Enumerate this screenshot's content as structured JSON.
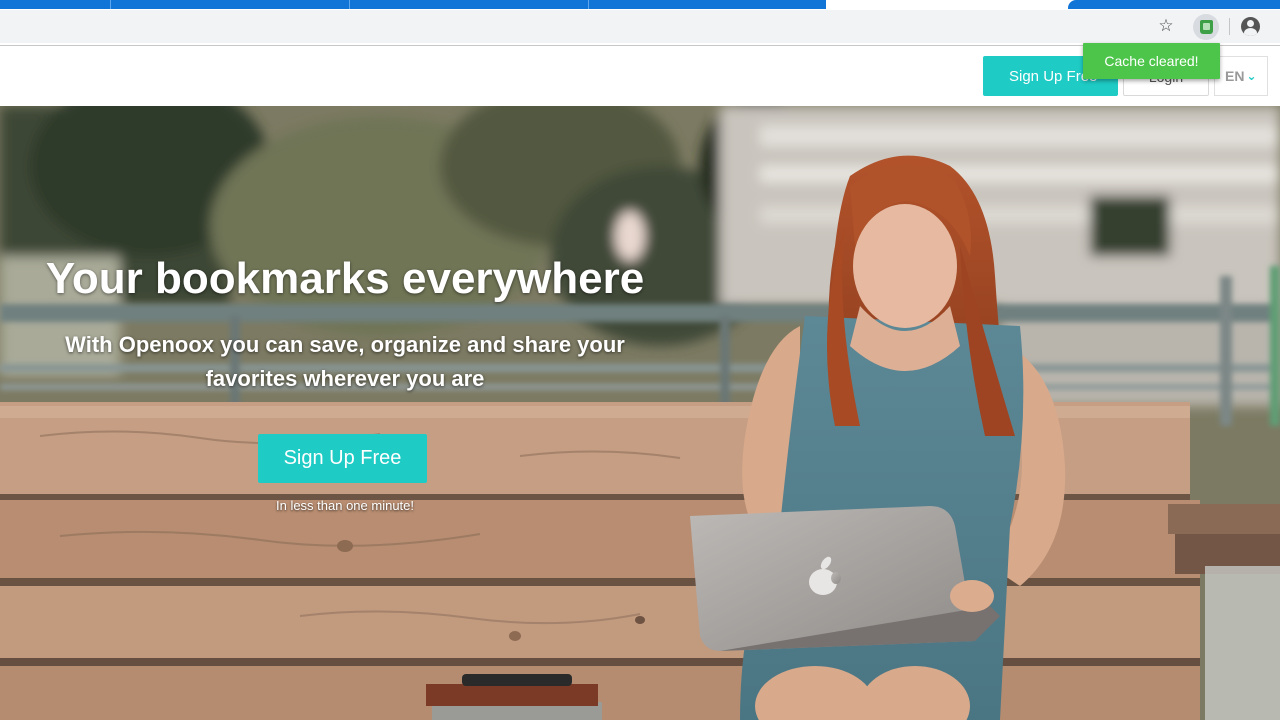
{
  "toast": {
    "message": "Cache cleared!"
  },
  "header": {
    "signup_label": "Sign Up Free",
    "login_label": "Login",
    "language": "EN"
  },
  "hero": {
    "headline": "Your bookmarks everywhere",
    "subline": "With Openoox you can save, organize and share your favorites wherever you are",
    "cta_label": "Sign Up Free",
    "hint": "In less than one minute!"
  },
  "colors": {
    "accent": "#1ecbc5",
    "toast": "#4dc54a",
    "browser_tab": "#1175d8"
  },
  "icons": [
    "star-icon",
    "extension-icon",
    "profile-icon",
    "chevron-down-icon"
  ]
}
